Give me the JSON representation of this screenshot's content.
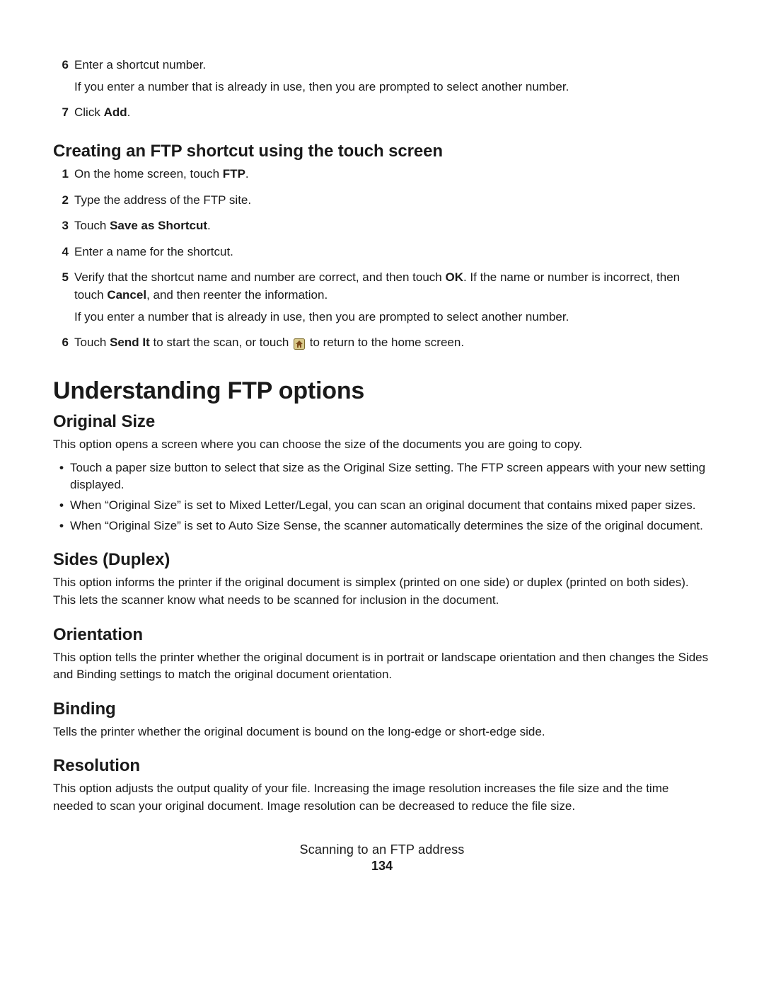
{
  "top_steps": {
    "step6": {
      "num": "6",
      "text": "Enter a shortcut number.",
      "note": "If you enter a number that is already in use, then you are prompted to select another number."
    },
    "step7": {
      "num": "7",
      "prefix": "Click ",
      "bold": "Add",
      "suffix": "."
    }
  },
  "heading_touch": "Creating an FTP shortcut using the touch screen",
  "touch_steps": {
    "s1": {
      "num": "1",
      "prefix": "On the home screen, touch ",
      "bold": "FTP",
      "suffix": "."
    },
    "s2": {
      "num": "2",
      "text": "Type the address of the FTP site."
    },
    "s3": {
      "num": "3",
      "prefix": "Touch ",
      "bold": "Save as Shortcut",
      "suffix": "."
    },
    "s4": {
      "num": "4",
      "text": "Enter a name for the shortcut."
    },
    "s5": {
      "num": "5",
      "p1a": "Verify that the shortcut name and number are correct, and then touch ",
      "p1b": "OK",
      "p1c": ". If the name or number is incorrect, then touch ",
      "p1d": "Cancel",
      "p1e": ", and then reenter the information.",
      "note": "If you enter a number that is already in use, then you are prompted to select another number."
    },
    "s6": {
      "num": "6",
      "prefix": "Touch ",
      "bold": "Send It",
      "mid": " to start the scan, or touch ",
      "suffix": " to return to the home screen."
    }
  },
  "heading_options": "Understanding FTP options",
  "original_size": {
    "title": "Original Size",
    "intro": "This option opens a screen where you can choose the size of the documents you are going to copy.",
    "b1": "Touch a paper size button to select that size as the Original Size setting. The FTP screen appears with your new setting displayed.",
    "b2": "When “Original Size” is set to Mixed Letter/Legal, you can scan an original document that contains mixed paper sizes.",
    "b3": "When “Original Size” is set to Auto Size Sense, the scanner automatically determines the size of the original document."
  },
  "sides": {
    "title": "Sides (Duplex)",
    "text": "This option informs the printer if the original document is simplex (printed on one side) or duplex (printed on both sides). This lets the scanner know what needs to be scanned for inclusion in the document."
  },
  "orientation": {
    "title": "Orientation",
    "text": "This option tells the printer whether the original document is in portrait or landscape orientation and then changes the Sides and Binding settings to match the original document orientation."
  },
  "binding": {
    "title": "Binding",
    "text": "Tells the printer whether the original document is bound on the long-edge or short-edge side."
  },
  "resolution": {
    "title": "Resolution",
    "text": "This option adjusts the output quality of your file. Increasing the image resolution increases the file size and the time needed to scan your original document. Image resolution can be decreased to reduce the file size."
  },
  "footer": {
    "title": "Scanning to an FTP address",
    "page": "134"
  }
}
